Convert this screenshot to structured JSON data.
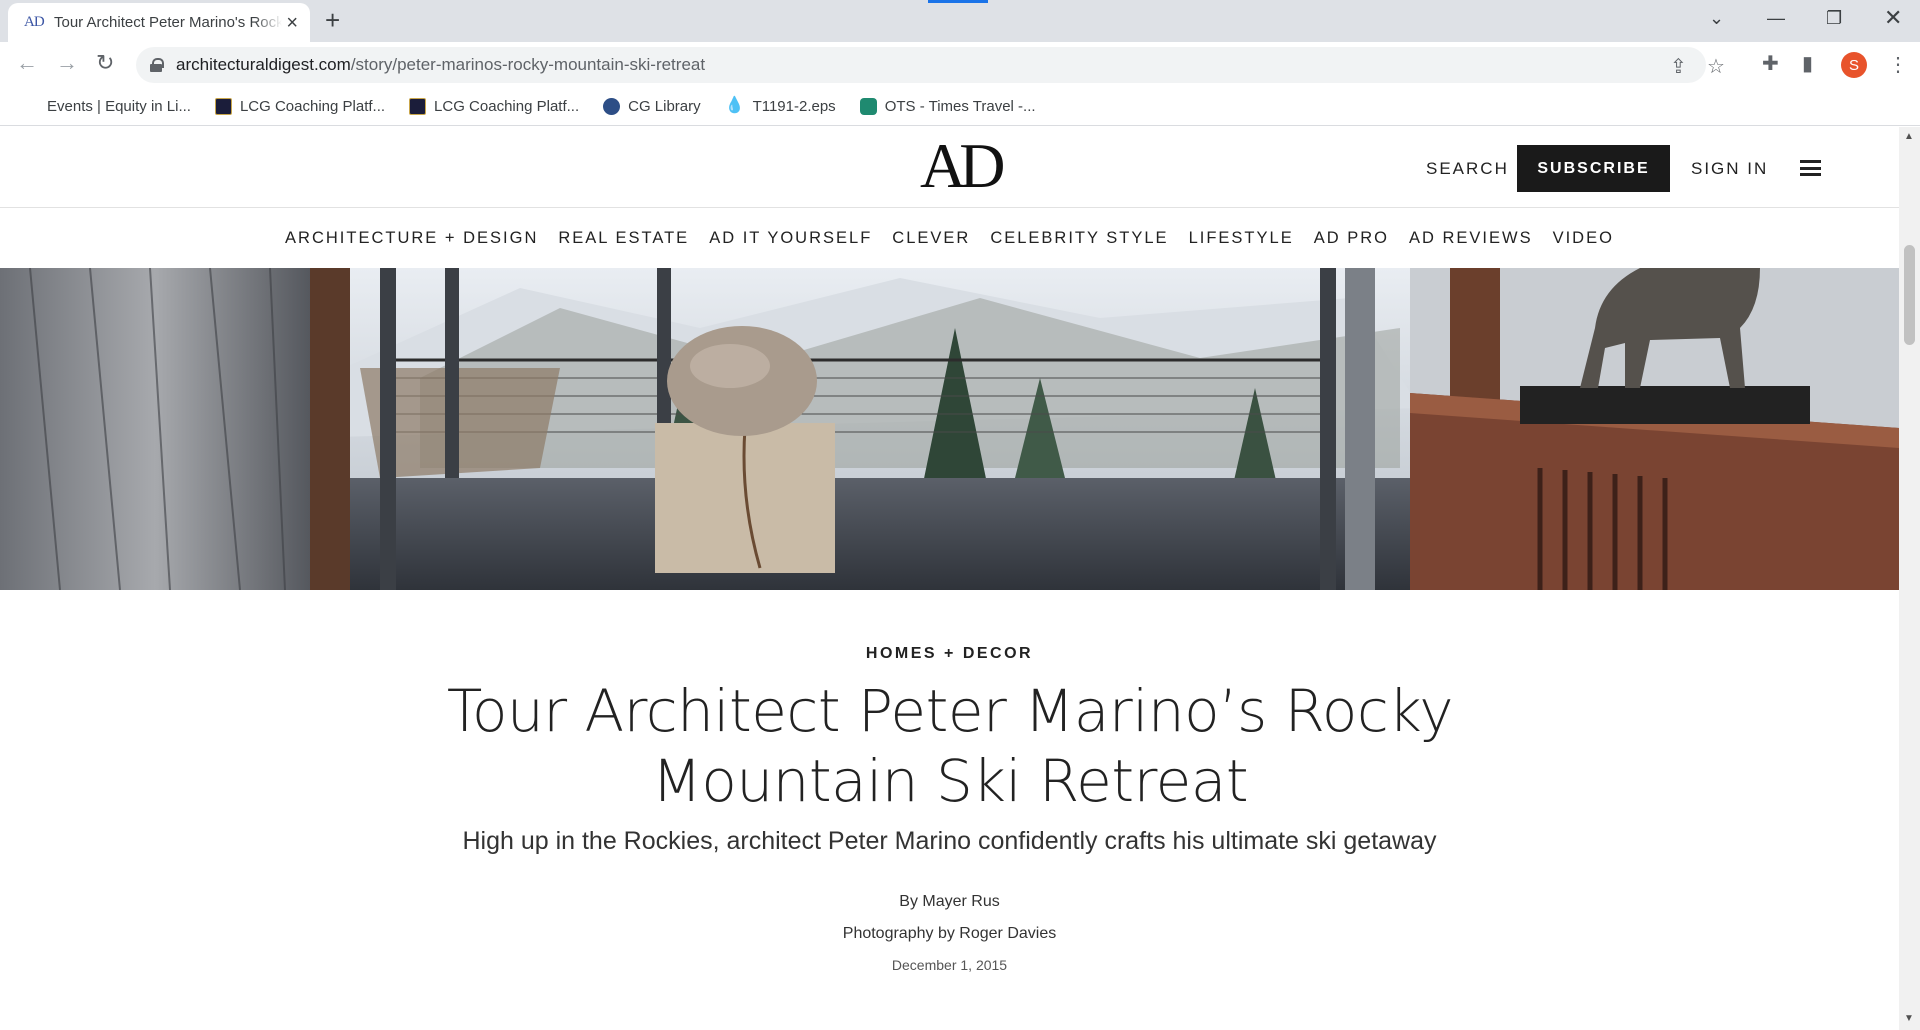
{
  "browser": {
    "tab": {
      "favicon_text": "AD",
      "title": "Tour Architect Peter Marino's Rocky Mountain Ski Retreat"
    },
    "url": {
      "domain": "architecturaldigest.com",
      "path": "/story/peter-marinos-rocky-mountain-ski-retreat"
    },
    "profile_initial": "S",
    "bookmarks": [
      {
        "label": "Events | Equity in Li...",
        "icon": "none"
      },
      {
        "label": "LCG Coaching Platf...",
        "icon": "lcg-logo-icon"
      },
      {
        "label": "LCG Coaching Platf...",
        "icon": "lcg-logo-icon"
      },
      {
        "label": "CG Library",
        "icon": "globe-icon"
      },
      {
        "label": "T1191-2.eps",
        "icon": "droplet-icon"
      },
      {
        "label": "OTS - Times Travel -...",
        "icon": "ots-icon"
      }
    ]
  },
  "site": {
    "logo": "AD",
    "header": {
      "search_label": "SEARCH",
      "subscribe_label": "SUBSCRIBE",
      "signin_label": "SIGN IN"
    },
    "nav": [
      "ARCHITECTURE + DESIGN",
      "REAL ESTATE",
      "AD IT YOURSELF",
      "CLEVER",
      "CELEBRITY STYLE",
      "LIFESTYLE",
      "AD PRO",
      "AD REVIEWS",
      "VIDEO"
    ]
  },
  "article": {
    "rubric": "HOMES + DECOR",
    "headline": "Tour Architect Peter Marino’s Rocky Mountain Ski Retreat",
    "dek": "High up in the Rockies, architect Peter Marino confidently crafts his ultimate ski getaway",
    "byline": "By Mayer Rus",
    "photo_credit": "Photography by Roger Davies",
    "date": "December 1, 2015"
  }
}
